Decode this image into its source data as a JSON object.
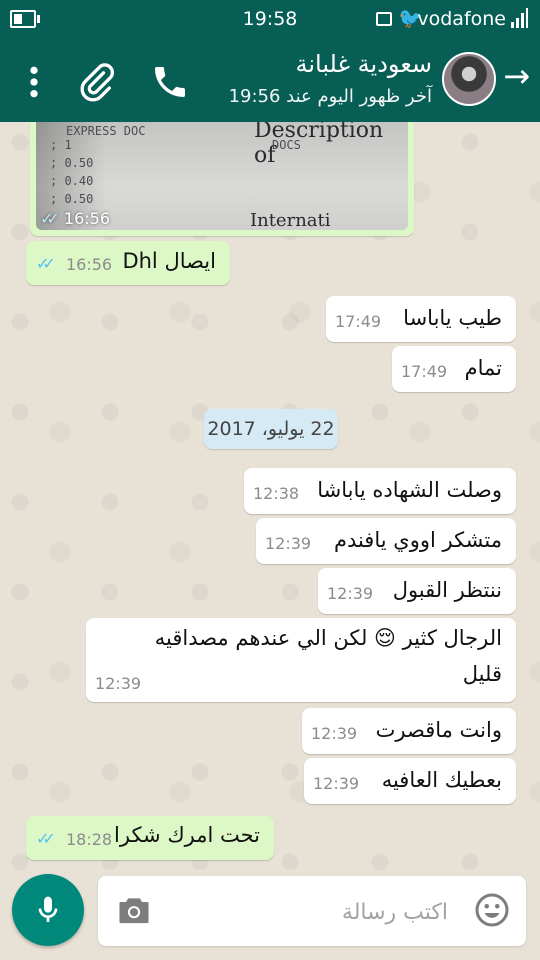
{
  "status_bar": {
    "time": "19:58",
    "carrier": "vodafone"
  },
  "header": {
    "contact_name": "سعودية غلبانة",
    "last_seen": "آخر ظهور اليوم عند 19:56"
  },
  "image_message": {
    "time": "16:56",
    "photo_lines": [
      "EXPRESS DOC",
      "; 1",
      "; 0.50",
      "; 0.40",
      "; 0.50"
    ],
    "photo_heading": "Description of",
    "photo_docs": "DOCS",
    "photo_bottom": "Internati"
  },
  "messages": [
    {
      "direction": "out",
      "text": "ايصال Dhl",
      "time": "16:56"
    },
    {
      "direction": "in",
      "text": "طيب ياباسا",
      "time": "17:49"
    },
    {
      "direction": "in",
      "text": "تمام",
      "time": "17:49"
    },
    {
      "direction": "in",
      "text": "وصلت الشهاده ياباشا",
      "time": "12:38"
    },
    {
      "direction": "in",
      "text": "متشكر اووي يافندم",
      "time": "12:39"
    },
    {
      "direction": "in",
      "text": "ننتظر القبول",
      "time": "12:39"
    },
    {
      "direction": "in",
      "text_line1": "الرجال كثير 😌 لكن الي عندهم مصداقيه",
      "text_line2": "قليل",
      "time": "12:39"
    },
    {
      "direction": "in",
      "text": "وانت ماقصرت",
      "time": "12:39"
    },
    {
      "direction": "in",
      "text": "بعطيك العافيه",
      "time": "12:39"
    },
    {
      "direction": "out",
      "text": "تحت امرك شكرا",
      "time": "18:28"
    }
  ],
  "date_separator": "22 يوليو، 2017",
  "composer": {
    "placeholder": "اكتب رسالة"
  },
  "colors": {
    "header": "#075e54",
    "outgoing": "#dcf8c6",
    "incoming": "#ffffff",
    "read_ticks": "#4fc3f7",
    "mic_button": "#00897b"
  },
  "icons": [
    "battery-icon",
    "gallery-icon",
    "twitter-icon",
    "signal-icon",
    "back-arrow-icon",
    "more-icon",
    "attach-icon",
    "call-icon",
    "double-check-icon",
    "camera-icon",
    "emoji-icon",
    "mic-icon"
  ]
}
